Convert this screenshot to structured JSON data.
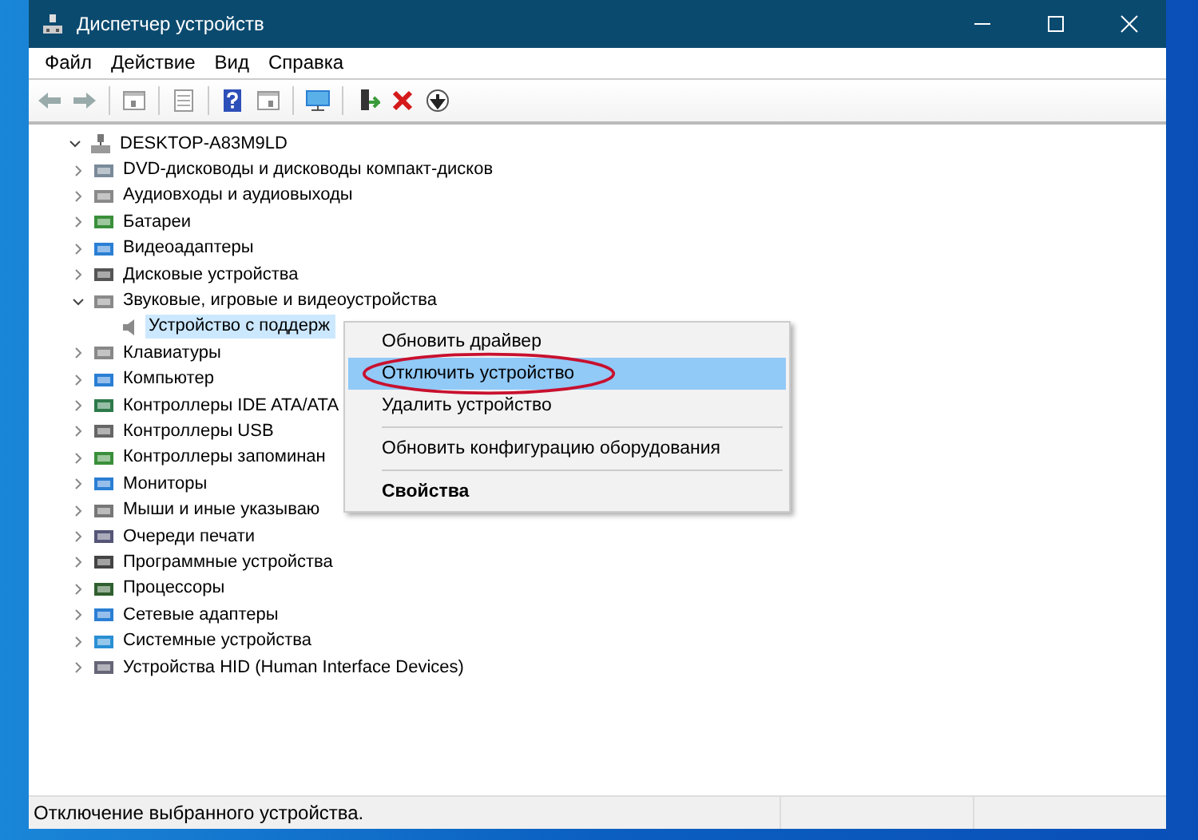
{
  "window": {
    "title": "Диспетчер устройств"
  },
  "menu_bar": [
    "Файл",
    "Действие",
    "Вид",
    "Справка"
  ],
  "tree": {
    "label": "DESKTOP-A83M9LD",
    "expanded": true,
    "selected": false,
    "children": [
      {
        "label": "DVD-дисководы и дисководы компакт-дисков",
        "expanded": false,
        "selected": false
      },
      {
        "label": "Аудиовходы и аудиовыходы",
        "expanded": false,
        "selected": false
      },
      {
        "label": "Батареи",
        "expanded": false,
        "selected": false
      },
      {
        "label": "Видеоадаптеры",
        "expanded": false,
        "selected": false
      },
      {
        "label": "Дисковые устройства",
        "expanded": false,
        "selected": false
      },
      {
        "label": "Звуковые, игровые и видеоустройства",
        "expanded": true,
        "selected": false,
        "children": [
          {
            "label": "Устройство с поддерж",
            "selected": true
          }
        ]
      },
      {
        "label": "Клавиатуры",
        "expanded": false,
        "selected": false
      },
      {
        "label": "Компьютер",
        "expanded": false,
        "selected": false
      },
      {
        "label": "Контроллеры IDE ATA/ATA",
        "expanded": false,
        "selected": false
      },
      {
        "label": "Контроллеры USB",
        "expanded": false,
        "selected": false
      },
      {
        "label": "Контроллеры запоминан",
        "expanded": false,
        "selected": false
      },
      {
        "label": "Мониторы",
        "expanded": false,
        "selected": false
      },
      {
        "label": "Мыши и иные указываю",
        "expanded": false,
        "selected": false
      },
      {
        "label": "Очереди печати",
        "expanded": false,
        "selected": false
      },
      {
        "label": "Программные устройства",
        "expanded": false,
        "selected": false
      },
      {
        "label": "Процессоры",
        "expanded": false,
        "selected": false
      },
      {
        "label": "Сетевые адаптеры",
        "expanded": false,
        "selected": false
      },
      {
        "label": "Системные устройства",
        "expanded": false,
        "selected": false
      },
      {
        "label": "Устройства HID (Human Interface Devices)",
        "expanded": false,
        "selected": false
      }
    ]
  },
  "context_menu": [
    {
      "kind": "item",
      "label": "Обновить драйвер",
      "selected": false,
      "default": false
    },
    {
      "kind": "item",
      "label": "Отключить устройство",
      "selected": true,
      "default": false,
      "circled": true
    },
    {
      "kind": "item",
      "label": "Удалить устройство",
      "selected": false,
      "default": false
    },
    {
      "kind": "separator"
    },
    {
      "kind": "item",
      "label": "Обновить конфигурацию оборудования",
      "selected": false,
      "default": false
    },
    {
      "kind": "separator"
    },
    {
      "kind": "item",
      "label": "Свойства",
      "selected": false,
      "default": true
    }
  ],
  "status_bar": {
    "text": "Отключение выбранного устройства."
  }
}
